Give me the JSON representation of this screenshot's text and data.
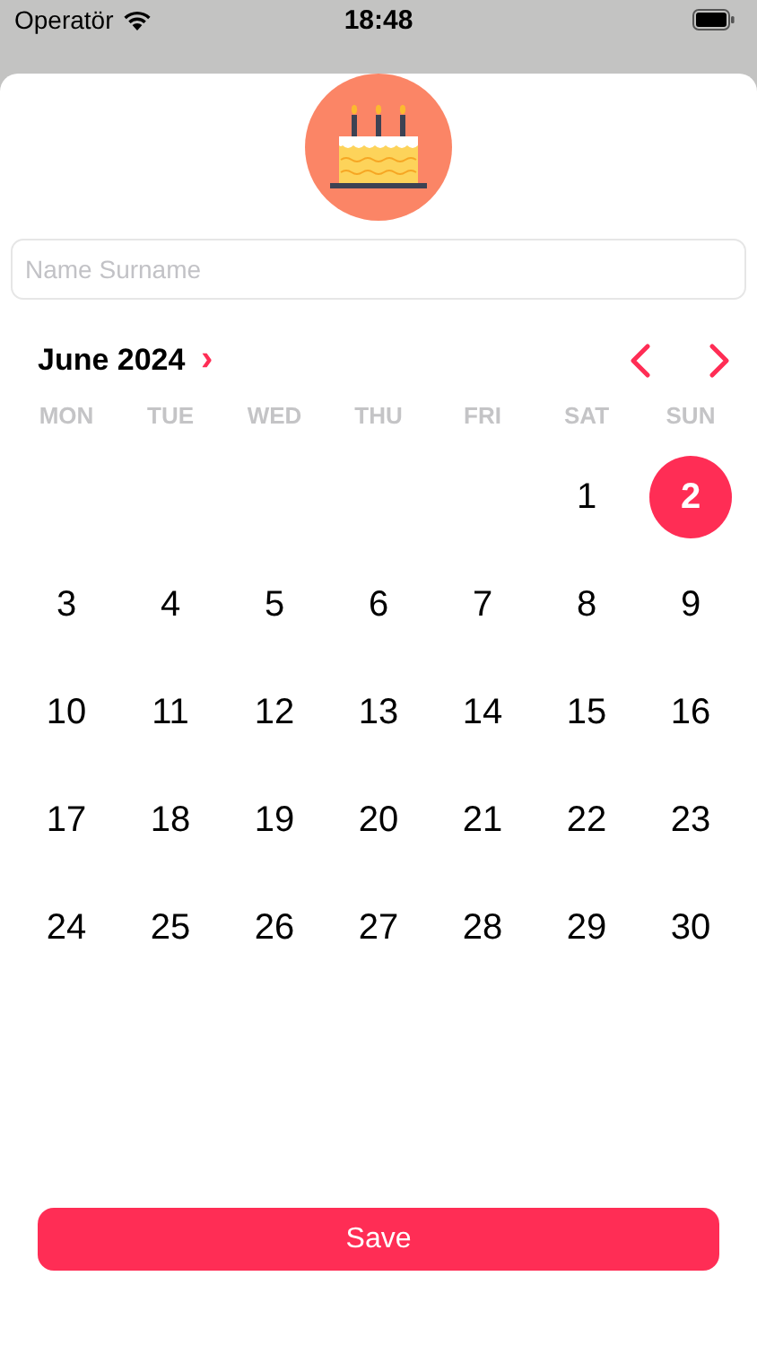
{
  "status_bar": {
    "carrier": "Operatör",
    "time": "18:48"
  },
  "name_field": {
    "placeholder": "Name Surname"
  },
  "calendar": {
    "month": "June 2024",
    "month_chevron": "›",
    "weekdays": [
      "MON",
      "TUE",
      "WED",
      "THU",
      "FRI",
      "SAT",
      "SUN"
    ],
    "weeks": [
      {
        "days": [
          {
            "label": "1",
            "selected": false
          },
          {
            "label": "2",
            "selected": true
          }
        ]
      },
      {
        "days": [
          {
            "label": "3",
            "selected": false
          },
          {
            "label": "4",
            "selected": false
          },
          {
            "label": "5",
            "selected": false
          },
          {
            "label": "6",
            "selected": false
          },
          {
            "label": "7",
            "selected": false
          },
          {
            "label": "8",
            "selected": false
          },
          {
            "label": "9",
            "selected": false
          }
        ]
      },
      {
        "days": [
          {
            "label": "10",
            "selected": false
          },
          {
            "label": "11",
            "selected": false
          },
          {
            "label": "12",
            "selected": false
          },
          {
            "label": "13",
            "selected": false
          },
          {
            "label": "14",
            "selected": false
          },
          {
            "label": "15",
            "selected": false
          },
          {
            "label": "16",
            "selected": false
          }
        ]
      },
      {
        "days": [
          {
            "label": "17",
            "selected": false
          },
          {
            "label": "18",
            "selected": false
          },
          {
            "label": "19",
            "selected": false
          },
          {
            "label": "20",
            "selected": false
          },
          {
            "label": "21",
            "selected": false
          },
          {
            "label": "22",
            "selected": false
          },
          {
            "label": "23",
            "selected": false
          }
        ]
      },
      {
        "days": [
          {
            "label": "24",
            "selected": false
          },
          {
            "label": "25",
            "selected": false
          },
          {
            "label": "26",
            "selected": false
          },
          {
            "label": "27",
            "selected": false
          },
          {
            "label": "28",
            "selected": false
          },
          {
            "label": "29",
            "selected": false
          },
          {
            "label": "30",
            "selected": false
          }
        ]
      }
    ]
  },
  "save_button": "Save"
}
